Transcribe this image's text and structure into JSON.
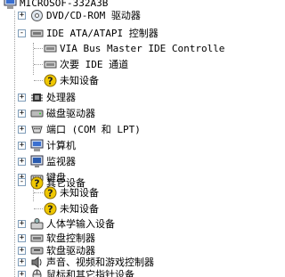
{
  "tree": {
    "root": {
      "label": "MICROSOF-332A3B",
      "icon": "computer-icon"
    },
    "items": [
      {
        "label": "DVD/CD-ROM 驱动器",
        "icon": "cdrom-drive-icon",
        "toggle": "+"
      },
      {
        "label": "IDE ATA/ATAPI 控制器",
        "icon": "ide-controller-icon",
        "toggle": "-",
        "children": [
          {
            "label": "VIA Bus Master IDE Controller",
            "icon": "ide-channel-icon"
          },
          {
            "label": "次要 IDE 通道",
            "icon": "ide-channel-icon"
          },
          {
            "label": "未知设备",
            "icon": "unknown-device-icon"
          }
        ]
      },
      {
        "label": "处理器",
        "icon": "processor-icon",
        "toggle": "+"
      },
      {
        "label": "磁盘驱动器",
        "icon": "disk-drive-icon",
        "toggle": "+"
      },
      {
        "label": "端口 (COM 和 LPT)",
        "icon": "port-icon",
        "toggle": "+"
      },
      {
        "label": "计算机",
        "icon": "computer-icon",
        "toggle": "+"
      },
      {
        "label": "监视器",
        "icon": "monitor-icon",
        "toggle": "+"
      },
      {
        "label": "键盘",
        "icon": "keyboard-icon",
        "toggle": "+"
      },
      {
        "label": "其它设备",
        "icon": "unknown-device-icon",
        "toggle": "-",
        "children": [
          {
            "label": "未知设备",
            "icon": "unknown-device-icon"
          },
          {
            "label": "未知设备",
            "icon": "unknown-device-icon"
          }
        ]
      },
      {
        "label": "人体学输入设备",
        "icon": "hid-icon",
        "toggle": "+"
      },
      {
        "label": "软盘控制器",
        "icon": "floppy-controller-icon",
        "toggle": "+"
      },
      {
        "label": "软盘驱动器",
        "icon": "floppy-drive-icon",
        "toggle": "+"
      },
      {
        "label": "声音、视频和游戏控制器",
        "icon": "sound-icon",
        "toggle": "+"
      },
      {
        "label": "鼠标和其它指针设备",
        "icon": "mouse-icon",
        "toggle": "+"
      }
    ]
  }
}
